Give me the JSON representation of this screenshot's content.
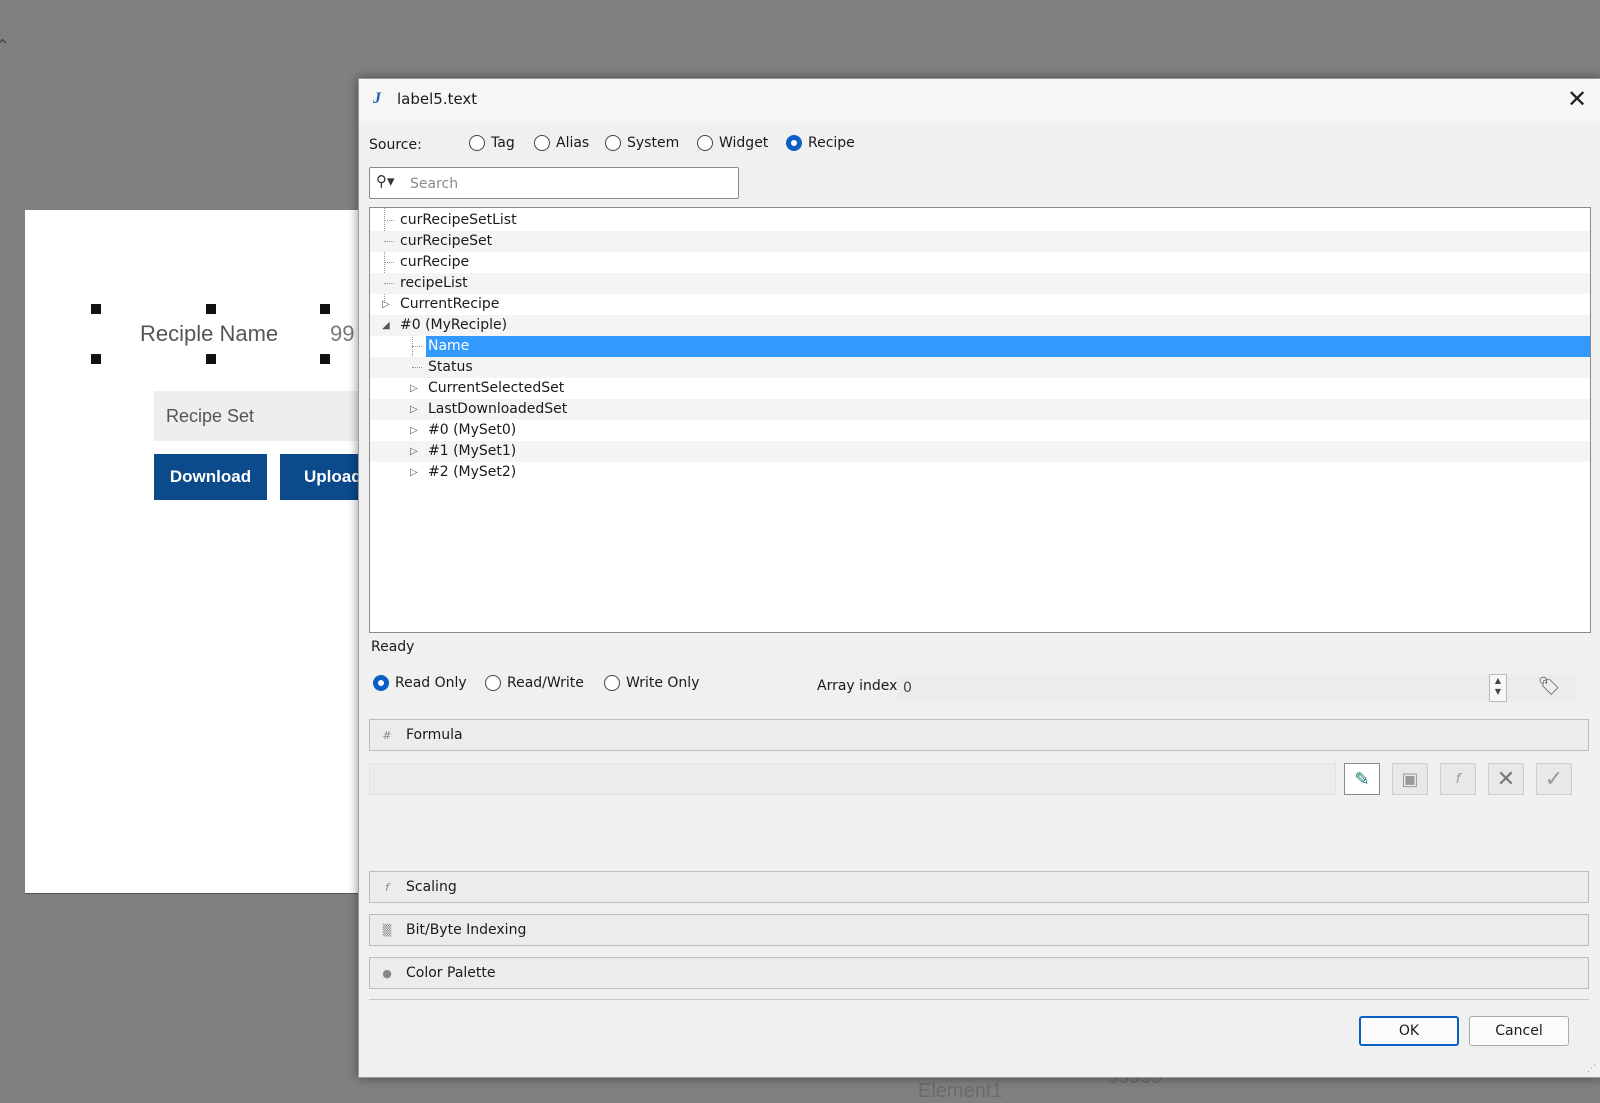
{
  "background": {
    "recipe_name_label": "Reciple Name",
    "value_partial": "99",
    "recipe_set_label": "Recipe Set",
    "download_label": "Download",
    "upload_label": "Upload",
    "element_label": "Element1",
    "element_value": "99999"
  },
  "dialog": {
    "title": "label5.text",
    "title_icon": "J",
    "close_glyph": "✕",
    "source_label": "Source:",
    "source_options": [
      "Tag",
      "Alias",
      "System",
      "Widget",
      "Recipe"
    ],
    "source_selected": "Recipe",
    "search_placeholder": "Search",
    "tree": [
      {
        "label": "curRecipeSetList",
        "level": 0,
        "expander": ""
      },
      {
        "label": "curRecipeSet",
        "level": 0,
        "expander": ""
      },
      {
        "label": "curRecipe",
        "level": 0,
        "expander": ""
      },
      {
        "label": "recipeList",
        "level": 0,
        "expander": ""
      },
      {
        "label": "CurrentRecipe",
        "level": 0,
        "expander": "collapsed"
      },
      {
        "label": "#0 (MyReciple)",
        "level": 0,
        "expander": "expanded"
      },
      {
        "label": "Name",
        "level": 1,
        "expander": "",
        "selected": true
      },
      {
        "label": "Status",
        "level": 1,
        "expander": ""
      },
      {
        "label": "CurrentSelectedSet",
        "level": 1,
        "expander": "collapsed"
      },
      {
        "label": "LastDownloadedSet",
        "level": 1,
        "expander": "collapsed"
      },
      {
        "label": "#0 (MySet0)",
        "level": 1,
        "expander": "collapsed"
      },
      {
        "label": "#1 (MySet1)",
        "level": 1,
        "expander": "collapsed"
      },
      {
        "label": "#2 (MySet2)",
        "level": 1,
        "expander": "collapsed"
      }
    ],
    "status": "Ready",
    "access_options": [
      "Read Only",
      "Read/Write",
      "Write Only"
    ],
    "access_selected": "Read Only",
    "array_index_label": "Array index",
    "array_index_value": "0",
    "sections": {
      "formula": "Formula",
      "scaling": "Scaling",
      "bitbyte": "Bit/Byte Indexing",
      "palette": "Color Palette"
    },
    "formula_value": "",
    "ok_label": "OK",
    "cancel_label": "Cancel"
  }
}
